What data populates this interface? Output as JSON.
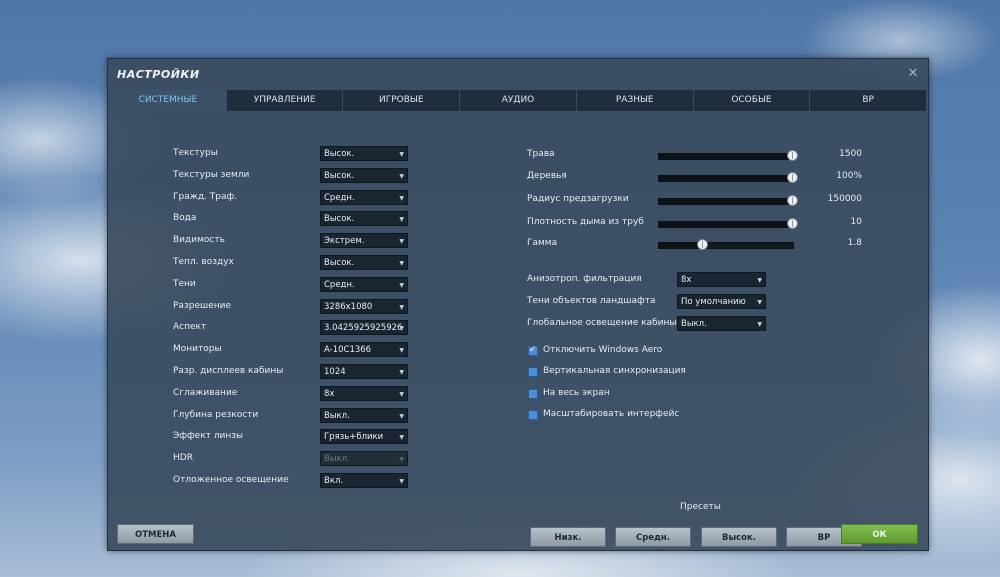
{
  "window": {
    "title": "НАСТРОЙКИ",
    "close_glyph": "✕"
  },
  "tabs": [
    {
      "label": "СИСТЕМНЫЕ",
      "active": true
    },
    {
      "label": "УПРАВЛЕНИЕ"
    },
    {
      "label": "ИГРОВЫЕ"
    },
    {
      "label": "АУДИО"
    },
    {
      "label": "РАЗНЫЕ"
    },
    {
      "label": "ОСОБЫЕ"
    },
    {
      "label": "ВР"
    }
  ],
  "left_settings": [
    {
      "label": "Текстуры",
      "value": "Высок."
    },
    {
      "label": "Текстуры земли",
      "value": "Высок."
    },
    {
      "label": "Гражд. Траф.",
      "value": "Средн."
    },
    {
      "label": "Вода",
      "value": "Высок."
    },
    {
      "label": "Видимость",
      "value": "Экстрем."
    },
    {
      "label": "Тепл. воздух",
      "value": "Высок."
    },
    {
      "label": "Тени",
      "value": "Средн."
    },
    {
      "label": "Разрешение",
      "value": "3286x1080"
    },
    {
      "label": "Аспект",
      "value": "3.0425925925926"
    },
    {
      "label": "Мониторы",
      "value": "A-10C1366"
    },
    {
      "label": "Разр. дисплеев кабины",
      "value": "1024"
    },
    {
      "label": "Сглаживание",
      "value": "8x"
    },
    {
      "label": "Глубина резкости",
      "value": "Выкл."
    },
    {
      "label": "Эффект линзы",
      "value": "Грязь+блики"
    },
    {
      "label": "HDR",
      "value": "Выкл.",
      "disabled": true
    },
    {
      "label": "Отложенное освещение",
      "value": "Вкл."
    }
  ],
  "sliders": [
    {
      "label": "Трава",
      "value": "1500",
      "level": 1.0
    },
    {
      "label": "Деревья",
      "value": "100%",
      "level": 1.0
    },
    {
      "label": "Радиус предзагрузки",
      "value": "150000",
      "level": 1.0
    },
    {
      "label": "Плотность дыма из труб",
      "value": "10",
      "level": 1.0
    },
    {
      "label": "Гамма",
      "value": "1.8",
      "level": 0.33
    }
  ],
  "right_dropdowns": [
    {
      "label": "Анизотроп. фильтрация",
      "value": "8x"
    },
    {
      "label": "Тени объектов ландшафта",
      "value": "По умолчанию"
    },
    {
      "label": "Глобальное освещение кабины",
      "value": "Выкл."
    }
  ],
  "checkboxes": [
    {
      "label": "Отключить Windows Aero",
      "checked": true
    },
    {
      "label": "Вертикальная синхронизация",
      "checked": false
    },
    {
      "label": "На весь экран",
      "checked": false
    },
    {
      "label": "Масштабировать интерфейс",
      "checked": false
    }
  ],
  "presets": {
    "title": "Пресеты",
    "buttons": [
      "Низк.",
      "Средн.",
      "Высок.",
      "ВР"
    ]
  },
  "footer": {
    "cancel_label": "ОТМЕНА",
    "ok_label": "ОК"
  },
  "colors": {
    "active_tab_text": "#7fc3f0",
    "ok_button": "#6aaa3a",
    "checkbox": "#4d8ed6"
  }
}
